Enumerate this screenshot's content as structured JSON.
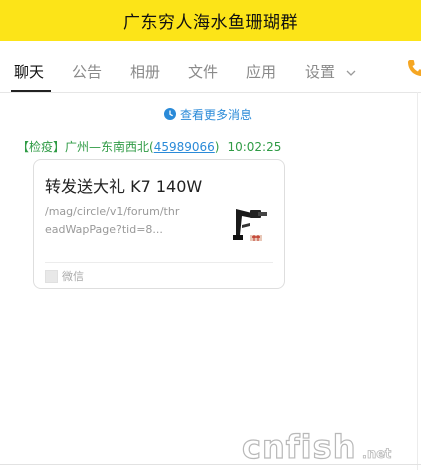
{
  "header": {
    "title": "广东穷人海水鱼珊瑚群"
  },
  "tabs": {
    "items": [
      {
        "label": "聊天"
      },
      {
        "label": "公告"
      },
      {
        "label": "相册"
      },
      {
        "label": "文件"
      },
      {
        "label": "应用"
      },
      {
        "label": "设置"
      }
    ]
  },
  "chat": {
    "more_messages": "查看更多消息",
    "sender": {
      "prefix": "【检疫】广州—东南西北(",
      "uid": "45989066",
      "suffix": ")",
      "time": "10:02:25"
    },
    "card": {
      "title": "转发送大礼 K7 140W",
      "url": "/mag/circle/v1/forum/threadWapPage?tid=8...",
      "source": "微信"
    }
  },
  "watermark": {
    "text": "cnfish",
    "sub": ".net"
  },
  "colors": {
    "header_bg": "#fce418",
    "sender_green": "#2f9b45",
    "link_blue": "#2a8ad8",
    "phone_icon": "#f5a623"
  }
}
